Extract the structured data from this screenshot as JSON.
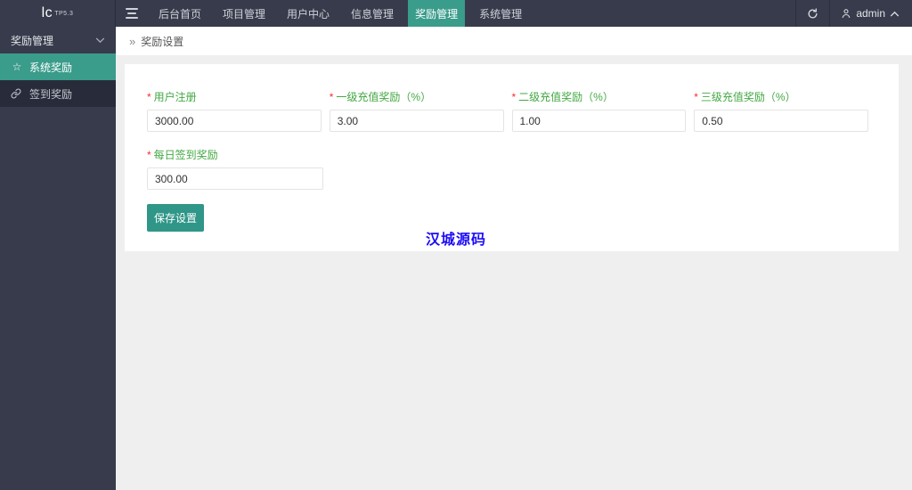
{
  "topbar": {
    "logo_text": "lc",
    "logo_version": "TP5.3",
    "nav_items": [
      {
        "label": "后台首页",
        "active": false
      },
      {
        "label": "项目管理",
        "active": false
      },
      {
        "label": "用户中心",
        "active": false
      },
      {
        "label": "信息管理",
        "active": false
      },
      {
        "label": "奖励管理",
        "active": true
      },
      {
        "label": "系统管理",
        "active": false
      }
    ],
    "username": "admin"
  },
  "sidebar": {
    "group_label": "奖励管理",
    "items": [
      {
        "label": "系统奖励",
        "icon": "star",
        "active": true
      },
      {
        "label": "签到奖励",
        "icon": "link",
        "active": false
      }
    ]
  },
  "breadcrumb": {
    "separator": "»",
    "title": "奖励设置"
  },
  "form": {
    "required_mark": "*",
    "fields": [
      {
        "label": "用户注册",
        "value": "3000.00"
      },
      {
        "label": "一级充值奖励（%）",
        "value": "3.00"
      },
      {
        "label": "二级充值奖励（%）",
        "value": "1.00"
      },
      {
        "label": "三级充值奖励（%）",
        "value": "0.50"
      },
      {
        "label": "每日签到奖励",
        "value": "300.00"
      }
    ],
    "save_button": "保存设置"
  },
  "watermark": "汉城源码",
  "icons": {
    "star": "☆"
  },
  "colors": {
    "topbar_bg": "#373b4b",
    "active_green": "#3a9c8b",
    "button_green": "#2f9688",
    "label_green": "#43a843",
    "watermark_blue": "#1c0cf8",
    "main_bg": "#efefef"
  }
}
